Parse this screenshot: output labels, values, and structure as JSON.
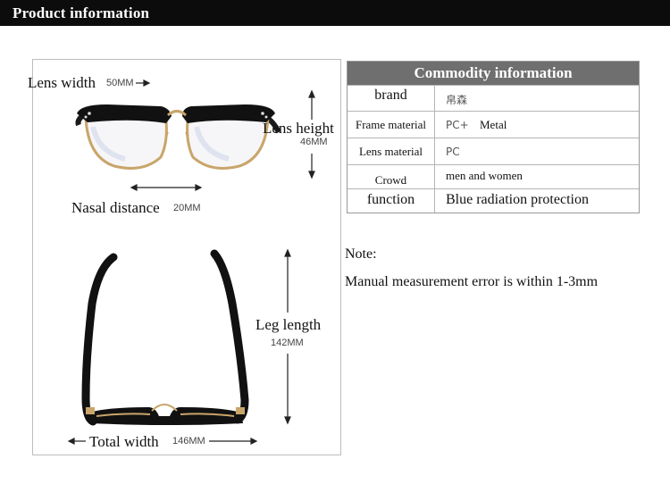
{
  "header": {
    "title": "Product information"
  },
  "dimensions": {
    "lens_width_label": "Lens width",
    "lens_width_value": "50MM",
    "lens_height_label": "Lens height",
    "lens_height_value": "46MM",
    "nasal_label": "Nasal distance",
    "nasal_value": "20MM",
    "leg_label": "Leg length",
    "leg_value": "142MM",
    "total_label": "Total width",
    "total_value": "146MM"
  },
  "table": {
    "title": "Commodity information",
    "rows": [
      {
        "label": "brand",
        "value": "帛森",
        "value2": ""
      },
      {
        "label": "Frame material",
        "value": "PC+",
        "value2": "Metal"
      },
      {
        "label": "Lens material",
        "value": "PC",
        "value2": ""
      },
      {
        "label": "Crowd",
        "value": "men and women",
        "value2": ""
      },
      {
        "label": "function",
        "value": "Blue radiation protection",
        "value2": ""
      }
    ]
  },
  "note": {
    "title": "Note:",
    "text": "Manual measurement error is within 1-3mm"
  },
  "colors": {
    "header_bg": "#0c0c0c",
    "table_header_bg": "#6f6f6f",
    "frame_gold": "#c9a56a"
  }
}
